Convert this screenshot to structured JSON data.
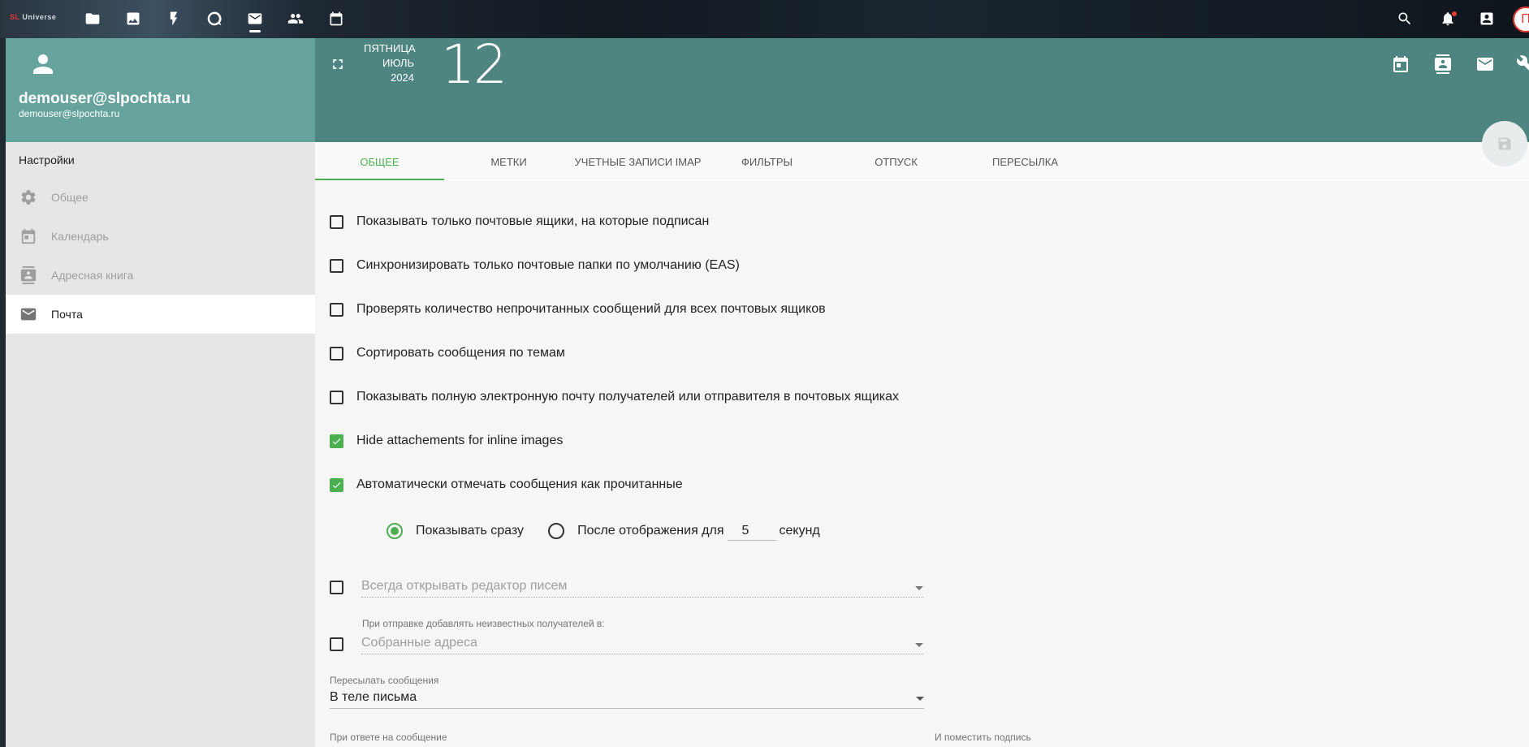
{
  "topbar": {
    "brand_prefix": "SL",
    "brand_name": "Universe",
    "avatar_letter": "П",
    "icons": [
      "folder-icon",
      "image-icon",
      "bolt-icon",
      "chat-icon",
      "mail-icon",
      "contacts-group-icon",
      "calendar-icon",
      "search-icon",
      "bell-icon",
      "contact-card-icon"
    ]
  },
  "sidebar": {
    "user_name": "demouser@slpochta.ru",
    "user_email": "demouser@slpochta.ru",
    "settings_title": "Настройки",
    "items": [
      {
        "label": "Общее",
        "icon": "gear-icon"
      },
      {
        "label": "Календарь",
        "icon": "calendar-icon"
      },
      {
        "label": "Адресная книга",
        "icon": "address-book-icon"
      },
      {
        "label": "Почта",
        "icon": "mail-icon",
        "active": true
      }
    ]
  },
  "header": {
    "weekday": "ПЯТНИЦА",
    "month": "ИЮЛЬ",
    "year": "2024",
    "day": "12"
  },
  "tabs": [
    {
      "label": "Общее",
      "active": true
    },
    {
      "label": "Метки"
    },
    {
      "label": "Учетные записи IMAP"
    },
    {
      "label": "Фильтры"
    },
    {
      "label": "Отпуск"
    },
    {
      "label": "Пересылка"
    }
  ],
  "options": [
    {
      "label": "Показывать только почтовые ящики, на которые подписан",
      "checked": false
    },
    {
      "label": "Синхронизировать только почтовые папки по умолчанию (EAS)",
      "checked": false
    },
    {
      "label": "Проверять количество непрочитанных сообщений для всех почтовых ящиков",
      "checked": false
    },
    {
      "label": "Сортировать сообщения по темам",
      "checked": false
    },
    {
      "label": "Показывать полную электронную почту получателей или отправителя в почтовых ящиках",
      "checked": false
    },
    {
      "label": "Hide attachements for inline images",
      "checked": true
    },
    {
      "label": "Автоматически отмечать сообщения как прочитанные",
      "checked": true
    }
  ],
  "read_mode": {
    "immediate_label": "Показывать сразу",
    "after_label": "После отображения для",
    "seconds_value": "5",
    "seconds_unit": "секунд",
    "selected": "immediate"
  },
  "editor_select": {
    "placeholder": "Всегда открывать редактор писем",
    "checked": false
  },
  "unknown_recipients": {
    "label": "При отправке добавлять неизвестных получателей в:",
    "value": "Собранные адреса",
    "checked": false
  },
  "forward": {
    "label": "Пересылать сообщения",
    "value": "В теле письма"
  },
  "reply": {
    "label": "При ответе на сообщение",
    "signature_label": "И поместить подпись"
  },
  "colors": {
    "accent": "#4caf50",
    "sidebar_header": "#65a39c",
    "main_header": "#4f8580"
  }
}
